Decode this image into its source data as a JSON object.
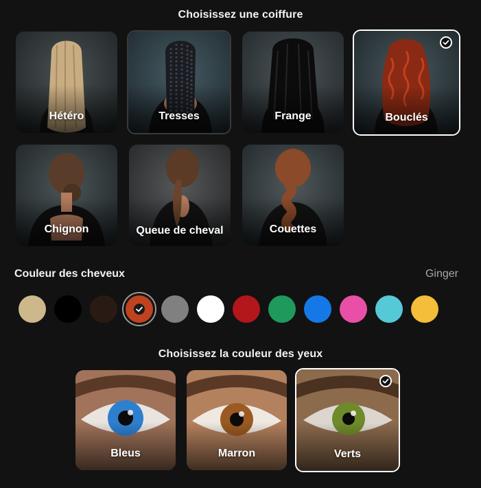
{
  "hairstyle_section": {
    "title": "Choisissez une coiffure",
    "options": [
      {
        "label": "Hétéro",
        "hair_color": "#c9ad82",
        "selected": false
      },
      {
        "label": "Tresses",
        "hair_color": "#1a1c22",
        "selected": false
      },
      {
        "label": "Frange",
        "hair_color": "#0c0c0d",
        "selected": false
      },
      {
        "label": "Bouclés",
        "hair_color": "#8a2a14",
        "selected": true
      },
      {
        "label": "Chignon",
        "hair_color": "#5a3c2a",
        "selected": false
      },
      {
        "label": "Queue de cheval",
        "hair_color": "#5b3a26",
        "selected": false
      },
      {
        "label": "Couettes",
        "hair_color": "#8b4a2a",
        "selected": false
      }
    ]
  },
  "hair_color_section": {
    "label": "Couleur des cheveux",
    "selected_name": "Ginger",
    "swatches": [
      {
        "color": "#cdb88c",
        "selected": false
      },
      {
        "color": "#000000",
        "selected": false
      },
      {
        "color": "#2a1a14",
        "selected": false
      },
      {
        "color": "#c0421f",
        "selected": true
      },
      {
        "color": "#808080",
        "selected": false
      },
      {
        "color": "#ffffff",
        "selected": false
      },
      {
        "color": "#b3161b",
        "selected": false
      },
      {
        "color": "#1f9a5c",
        "selected": false
      },
      {
        "color": "#1479e6",
        "selected": false
      },
      {
        "color": "#ea4fa8",
        "selected": false
      },
      {
        "color": "#56c9d6",
        "selected": false
      },
      {
        "color": "#f4bd3a",
        "selected": false
      }
    ]
  },
  "eye_section": {
    "title": "Choisissez la couleur des yeux",
    "options": [
      {
        "label": "Bleus",
        "iris_color": "#2f7fcf",
        "selected": false
      },
      {
        "label": "Marron",
        "iris_color": "#9a5a22",
        "selected": false
      },
      {
        "label": "Verts",
        "iris_color": "#6f8a2a",
        "selected": true
      }
    ]
  },
  "icons": {
    "check": "check-icon"
  }
}
